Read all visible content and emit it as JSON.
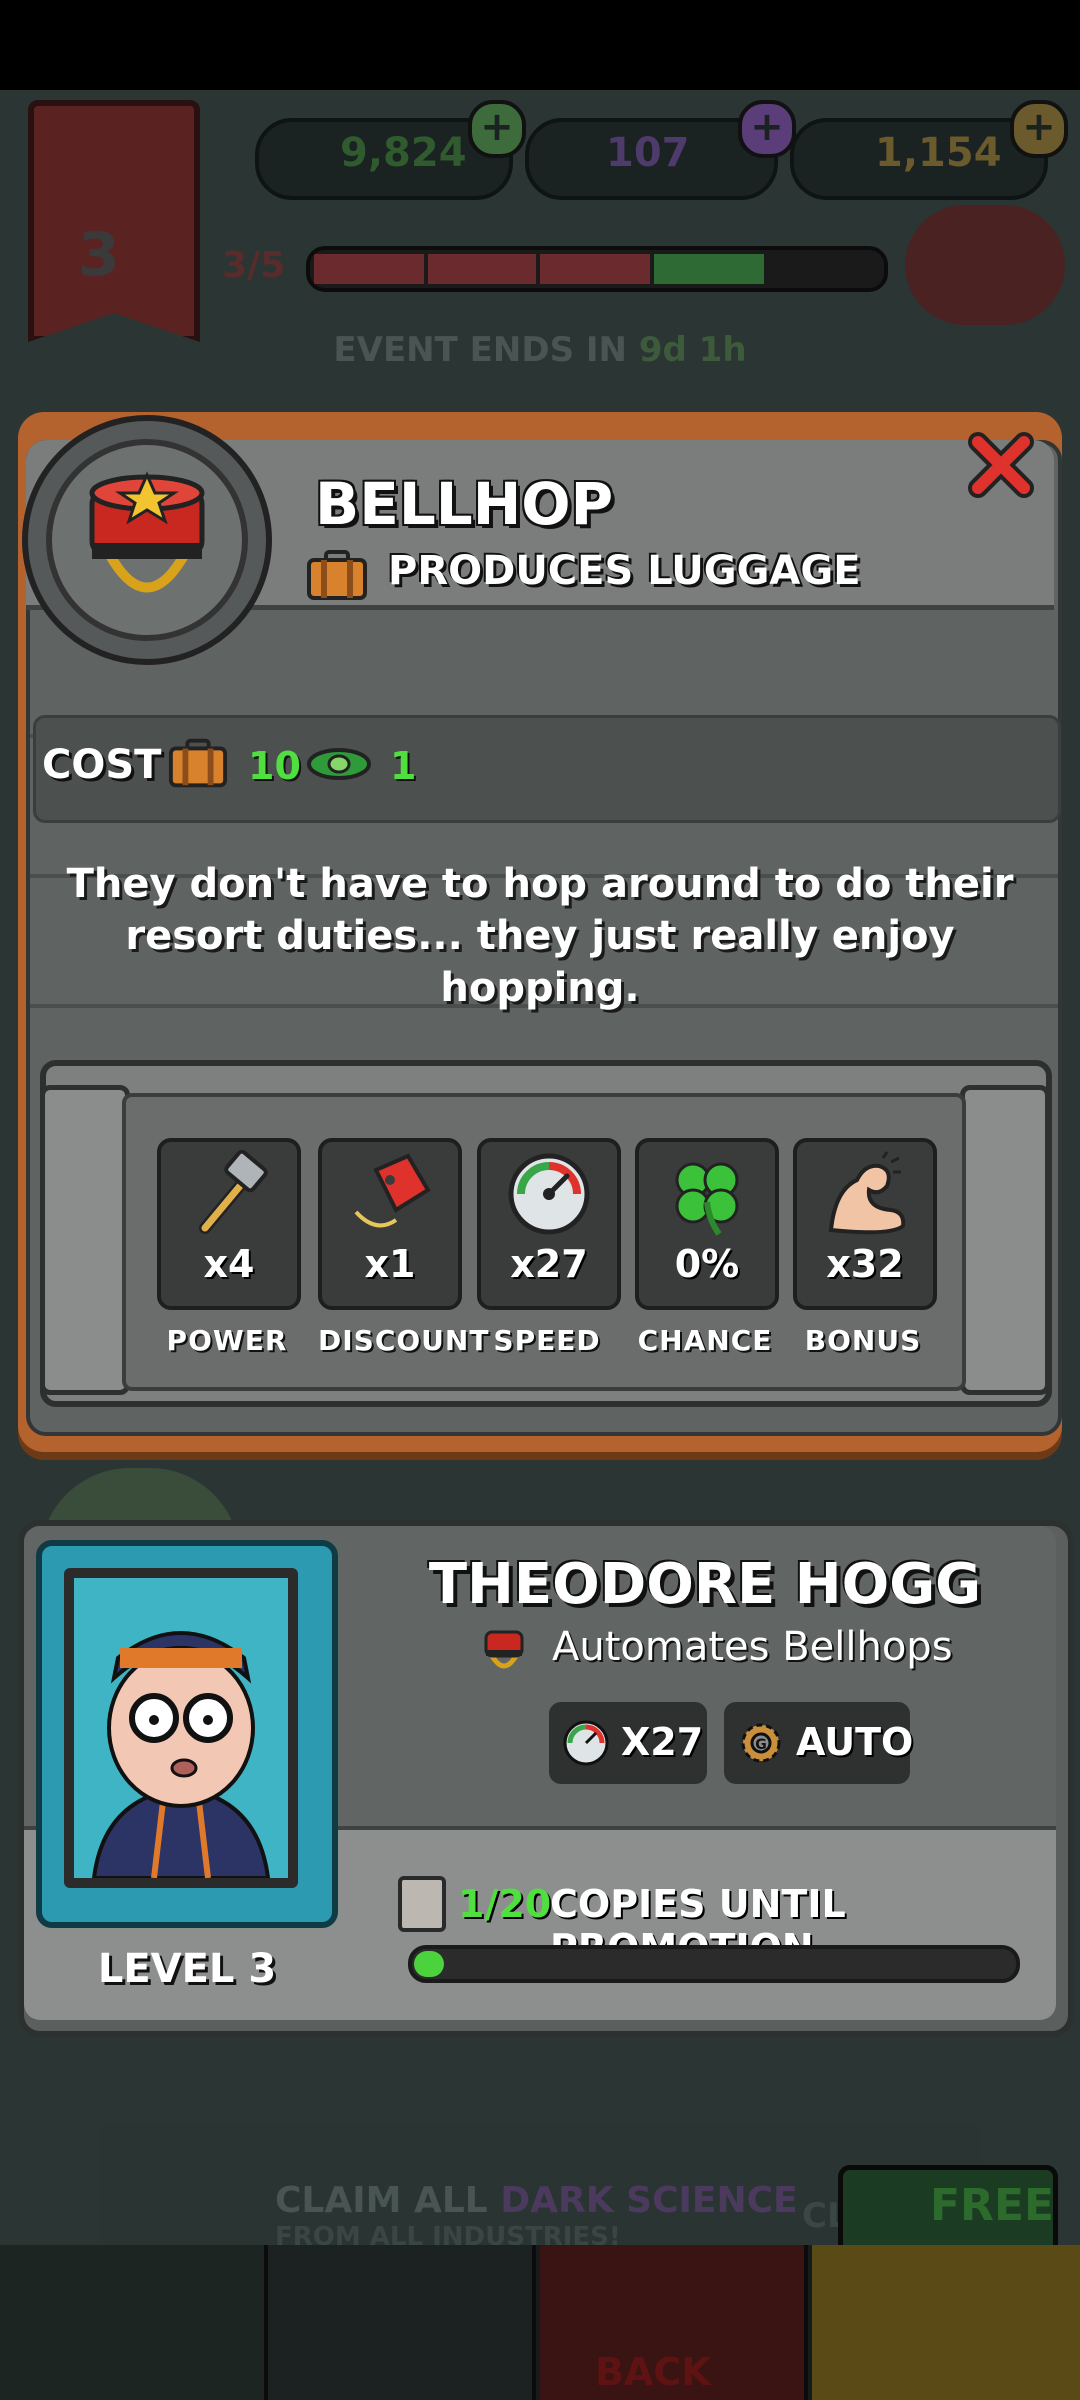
{
  "hud": {
    "banner_level": "3",
    "cash": "9,824",
    "potion": "107",
    "gold": "1,154",
    "progress": "3/5",
    "progress_fraction": 0.6,
    "event_label": "EVENT ENDS IN",
    "event_time": "9d 1h"
  },
  "card": {
    "title": "BELLHOP",
    "subtitle": "PRODUCES LUGGAGE",
    "cost_label": "COST",
    "cost_luggage": "10",
    "cost_cash": "1",
    "description": "They don't have to hop around to do their resort duties... they just really enjoy hopping.",
    "stats": [
      {
        "icon": "hammer-icon",
        "value": "x4",
        "label": "POWER"
      },
      {
        "icon": "price-tag-icon",
        "value": "x1",
        "label": "DISCOUNT"
      },
      {
        "icon": "speedometer-icon",
        "value": "x27",
        "label": "SPEED"
      },
      {
        "icon": "clover-icon",
        "value": "0%",
        "label": "CHANCE"
      },
      {
        "icon": "flexed-arm-icon",
        "value": "x32",
        "label": "BONUS"
      }
    ]
  },
  "manager": {
    "name": "THEODORE HOGG",
    "automates": "Automates Bellhops",
    "speed": "X27",
    "auto": "AUTO",
    "level": "LEVEL 3",
    "copies": "1/20",
    "copies_label": "COPIES UNTIL PROMOTION",
    "copies_fraction": 0.05
  },
  "bottom": {
    "claim_prefix": "CLAIM ALL",
    "claim_highlight": "DARK SCIENCE",
    "claim_sub": "FROM ALL INDUSTRIES!",
    "cl_text": "CL",
    "free_label": "FREE",
    "back_label": "BACK"
  },
  "colors": {
    "card_border": "#b5632e",
    "green_value": "#4fe040",
    "close_red": "#e0322c",
    "frame_teal": "#2c9ab0"
  }
}
